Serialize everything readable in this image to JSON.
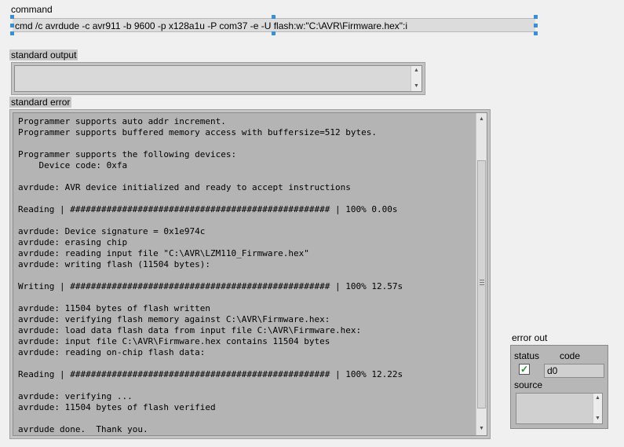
{
  "command": {
    "label": "command",
    "value": "cmd /c avrdude  -c avr911 -b 9600 -p x128a1u  -P com37  -e -U flash:w:\"C:\\AVR\\Firmware.hex\":i"
  },
  "standard_output": {
    "label": "standard output",
    "text": ""
  },
  "standard_error": {
    "label": "standard error",
    "text": "Programmer supports auto addr increment.\nProgrammer supports buffered memory access with buffersize=512 bytes.\n\nProgrammer supports the following devices:\n    Device code: 0xfa\n\navrdude: AVR device initialized and ready to accept instructions\n\nReading | ################################################## | 100% 0.00s\n\navrdude: Device signature = 0x1e974c\navrdude: erasing chip\navrdude: reading input file \"C:\\AVR\\LZM110_Firmware.hex\"\navrdude: writing flash (11504 bytes):\n\nWriting | ################################################## | 100% 12.57s\n\navrdude: 11504 bytes of flash written\navrdude: verifying flash memory against C:\\AVR\\Firmware.hex:\navrdude: load data flash data from input file C:\\AVR\\Firmware.hex:\navrdude: input file C:\\AVR\\Firmware.hex contains 11504 bytes\navrdude: reading on-chip flash data:\n\nReading | ################################################## | 100% 12.22s\n\navrdude: verifying ...\navrdude: 11504 bytes of flash verified\n\navrdude done.  Thank you."
  },
  "error_out": {
    "label": "error out",
    "status_label": "status",
    "code_label": "code",
    "code_value": "d0",
    "source_label": "source",
    "source_value": "",
    "status_ok": true
  },
  "icons": {
    "scroll_up": "scroll-up-arrow",
    "scroll_down": "scroll-down-arrow",
    "status": "checkmark"
  }
}
